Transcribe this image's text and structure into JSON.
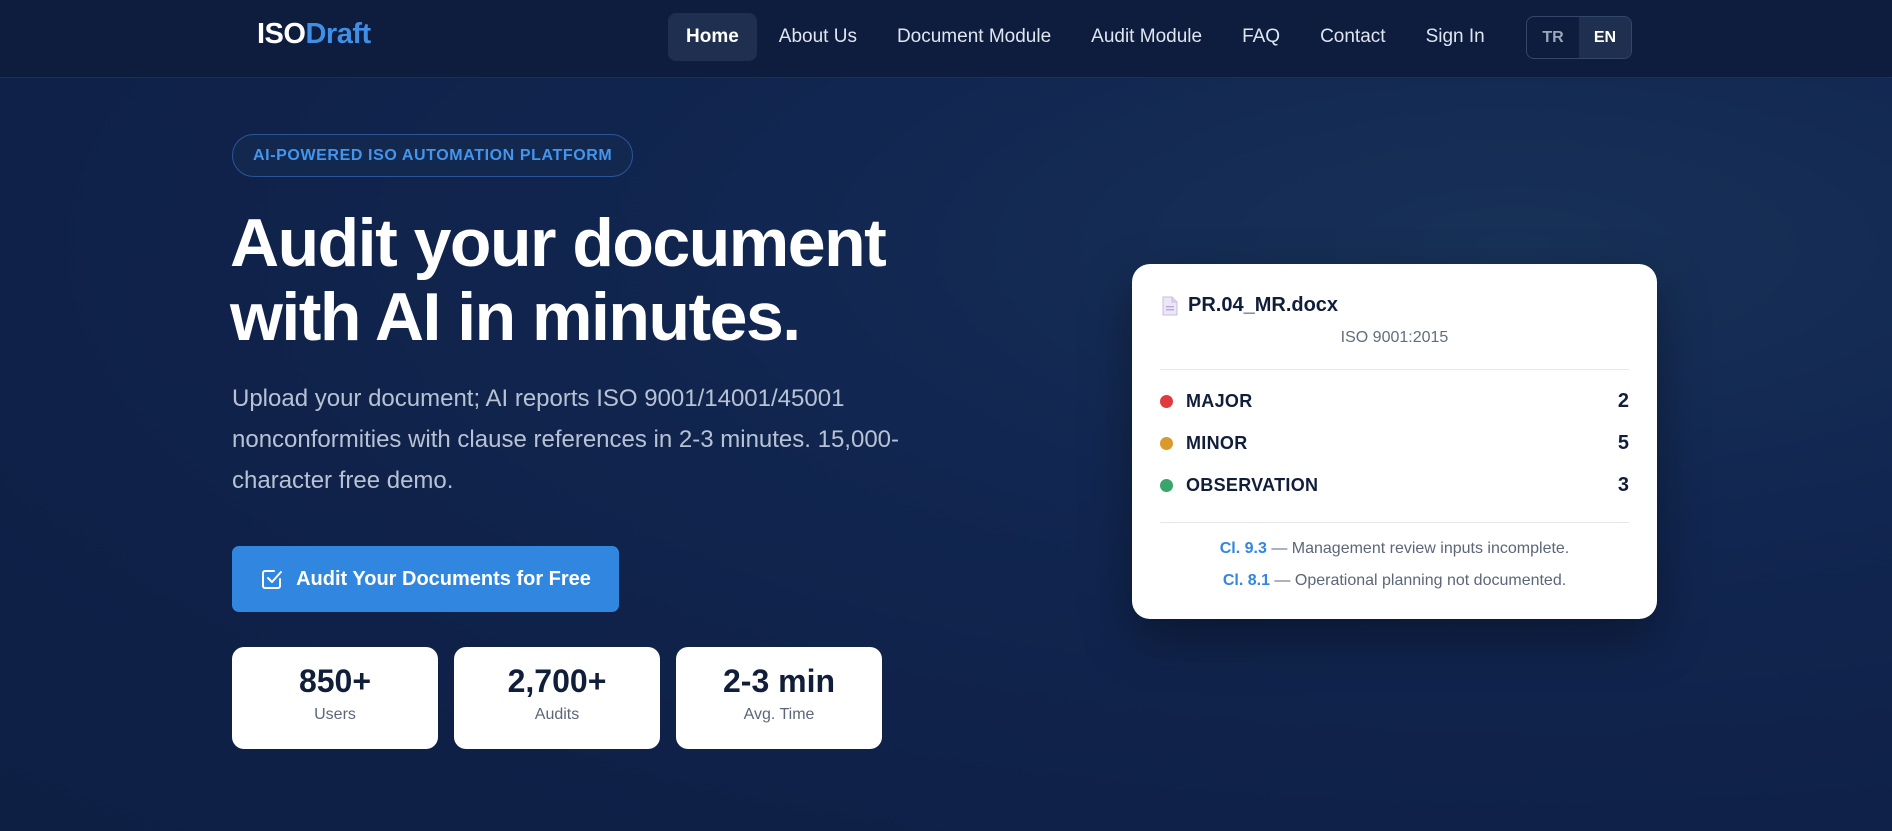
{
  "nav": {
    "logo_iso": "ISO",
    "logo_draft": "Draft",
    "links": [
      "Home",
      "About Us",
      "Document Module",
      "Audit Module",
      "FAQ",
      "Contact",
      "Sign In"
    ],
    "lang": [
      "TR",
      "EN"
    ]
  },
  "hero": {
    "badge": "AI-POWERED ISO AUTOMATION PLATFORM",
    "title": "Audit your document with AI in minutes.",
    "subtitle": "Upload your document; AI reports ISO 9001/14001/45001 nonconformities with clause references in 2-3 minutes. 15,000-character free demo.",
    "cta": "Audit Your Documents for Free"
  },
  "stats": [
    {
      "value": "850+",
      "label": "Users"
    },
    {
      "value": "2,700+",
      "label": "Audits"
    },
    {
      "value": "2-3 min",
      "label": "Avg. Time"
    }
  ],
  "report": {
    "file": "PR.04_MR.docx",
    "standard": "ISO 9001:2015",
    "severities": [
      {
        "label": "MAJOR",
        "count": "2",
        "color": "#e0393e"
      },
      {
        "label": "MINOR",
        "count": "5",
        "color": "#d99a2b"
      },
      {
        "label": "OBSERVATION",
        "count": "3",
        "color": "#3aa56a"
      }
    ],
    "findings": [
      {
        "clause": "Cl. 9.3",
        "text": "— Management review inputs incomplete."
      },
      {
        "clause": "Cl. 8.1",
        "text": "— Operational planning not documented."
      }
    ]
  },
  "colors": {
    "accent": "#3186e0",
    "background": "#0f2148"
  },
  "icons": {
    "cta": "checkbox-icon",
    "file": "document-icon"
  }
}
